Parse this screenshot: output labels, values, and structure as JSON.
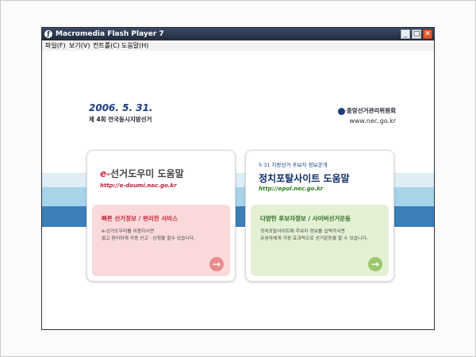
{
  "window": {
    "title": "Macromedia Flash Player 7",
    "min_glyph": "_",
    "max_glyph": "□",
    "close_glyph": "✕"
  },
  "menu": [
    {
      "label": "파일(F)"
    },
    {
      "label": "보기(V)"
    },
    {
      "label": "컨트롤(C)"
    },
    {
      "label": "도움말(H)"
    }
  ],
  "header": {
    "date": "2006. 5. 31.",
    "event": "제 4회 전국동시지방선거",
    "org_name": "중앙선거관리위원회",
    "org_url": "www.nec.go.kr"
  },
  "cards": [
    {
      "id": "edoumi",
      "title_prefix": "e-",
      "title": "선거도우미 도움말",
      "subtitle": "",
      "url": "http://e-doumi.nec.go.kr",
      "panel_title": "빠른 선거정보 / 편리한 서비스",
      "panel_desc_1": "e-선거도우미를 이용하시면",
      "panel_desc_2": "쉽고 편리하게 각종 신고 · 신청을 할수 있습니다.",
      "accent": "#d23b56",
      "panel_color": "#f9d9d9"
    },
    {
      "id": "epol",
      "title_prefix": "",
      "title": "정치포탈사이트 도움말",
      "subtitle": "5·31 지방선거 후보자 정보공개",
      "url": "http://epol.nec.go.kr",
      "panel_title": "다양한 후보자정보 / 사이버선거운동",
      "panel_desc_1": "정치포탈사이트에 후보자 정보를 입력하시면",
      "panel_desc_2": "유권자에게 가장 효과적으로 선거운동을 할 수 있습니다.",
      "accent": "#2a6e22",
      "panel_color": "#e4f0d4"
    }
  ],
  "icons": {
    "app": "flash-icon",
    "arrow": "arrow-right-icon",
    "logo": "nec-logo-icon"
  }
}
